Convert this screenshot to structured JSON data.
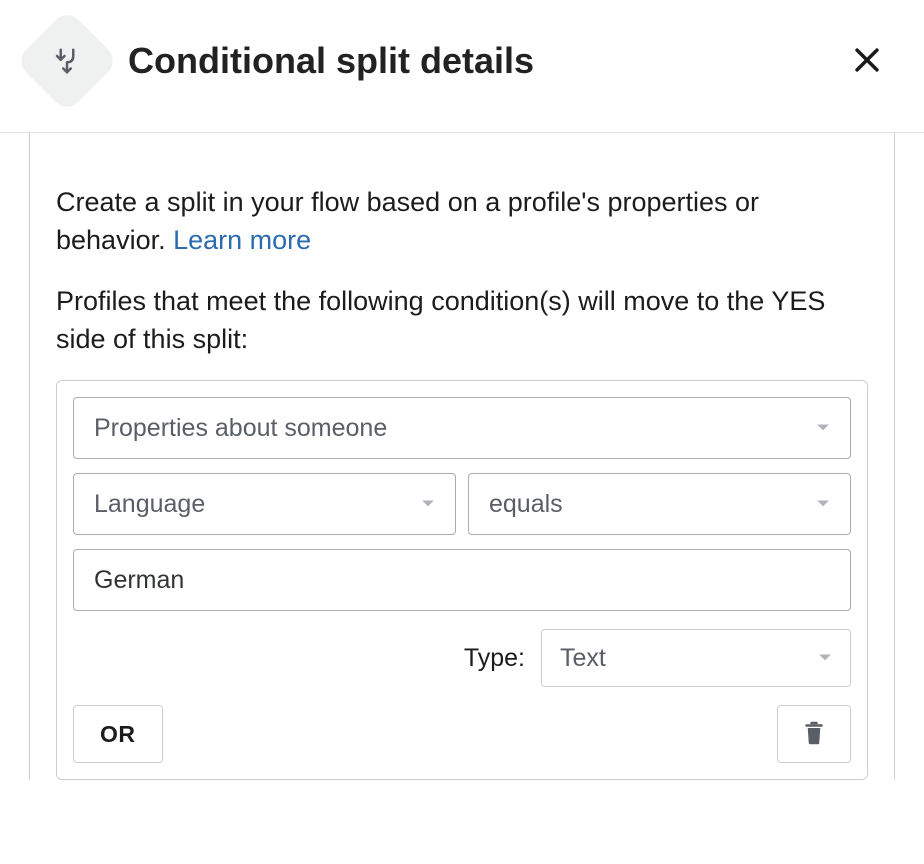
{
  "header": {
    "title": "Conditional split details"
  },
  "panel": {
    "description_prefix": "Create a split in your flow based on a profile's properties or behavior. ",
    "learn_more_label": "Learn more",
    "instructions": "Profiles that meet the following condition(s) will move to the YES side of this split:"
  },
  "condition": {
    "category": "Properties about someone",
    "property": "Language",
    "operator": "equals",
    "value": "German",
    "type_label": "Type:",
    "type_value": "Text"
  },
  "actions": {
    "or_label": "OR"
  }
}
